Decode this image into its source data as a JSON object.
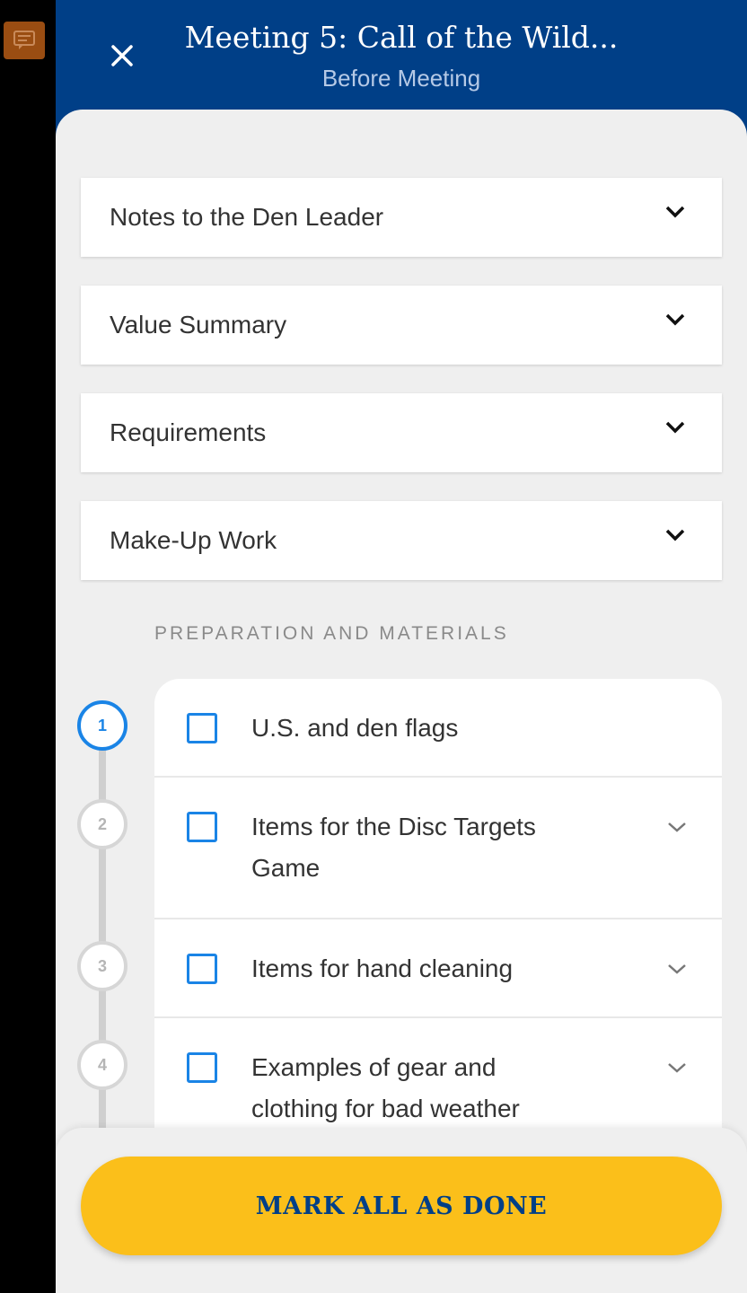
{
  "header": {
    "title": "Meeting 5: Call of the Wild...",
    "subtitle": "Before Meeting",
    "close_icon": "close-icon"
  },
  "sidebar": {
    "feedback_icon": "feedback-icon"
  },
  "accordions": [
    {
      "label": "Notes to the Den Leader"
    },
    {
      "label": "Value Summary"
    },
    {
      "label": "Requirements"
    },
    {
      "label": "Make-Up Work"
    }
  ],
  "section": {
    "title": "PREPARATION AND MATERIALS"
  },
  "steps": [
    "1",
    "2",
    "3",
    "4"
  ],
  "materials": [
    {
      "line1": "U.S. and den flags",
      "line2": "",
      "checked": false,
      "expandable": false
    },
    {
      "line1": "Items for the Disc Targets",
      "line2": "Game",
      "checked": false,
      "expandable": true
    },
    {
      "line1": "Items for hand cleaning",
      "line2": "",
      "checked": false,
      "expandable": true
    },
    {
      "line1": "Examples of gear and",
      "line2": "clothing for bad weather",
      "checked": false,
      "expandable": true
    }
  ],
  "footer": {
    "mark_all_label": "MARK ALL AS DONE"
  },
  "colors": {
    "header_blue": "#003f87",
    "accent_blue": "#1a84e6",
    "button_yellow": "#fbbf1a",
    "feedback_orange": "#9a4d12"
  }
}
